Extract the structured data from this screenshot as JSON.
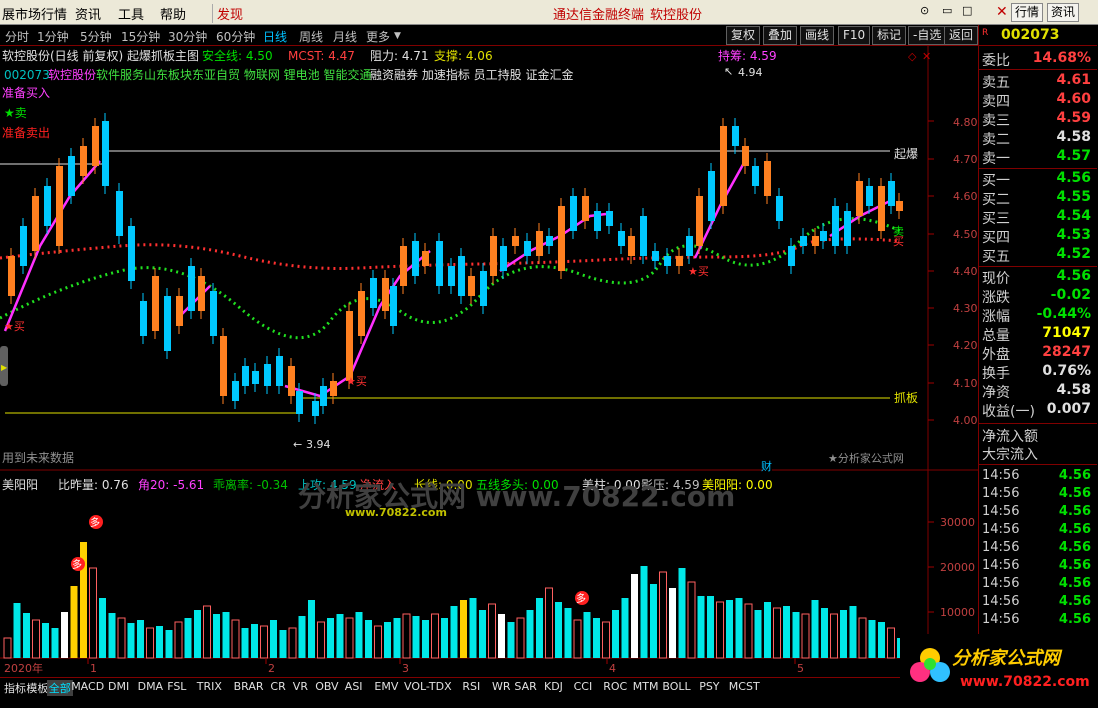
{
  "menu": {
    "items": [
      "展市场行情",
      "资讯",
      "工具",
      "帮助"
    ],
    "discover": "发现",
    "center_brand": "通达信金融终端",
    "stock_short": "软控股份",
    "right_buttons": [
      "行情",
      "资讯"
    ]
  },
  "period_bar": {
    "periods": [
      "分时",
      "1分钟",
      "5分钟",
      "15分钟",
      "30分钟",
      "60分钟",
      "日线",
      "周线",
      "月线",
      "更多"
    ],
    "active": "日线",
    "tools": [
      "复权",
      "叠加",
      "画线",
      "F10",
      "标记",
      "-自选",
      "返回"
    ]
  },
  "main_chart": {
    "title_line": "软控股份(日线 前复权) 起爆抓板主图",
    "safety_label": "安全线: 4.50",
    "mcst_label": "MCST: 4.47",
    "resist_label": "阻力: 4.71",
    "support_label": "支撑: 4.06",
    "info_code": "002073",
    "info_name": "软控股份",
    "info_tags_green": "软件服务山东板块东亚自贸 物联网 锂电池 智能交通",
    "info_tags_white": "融资融券 加速指标 员工持股 证金汇金",
    "legend_buy": "准备买入",
    "legend_star": "★卖",
    "legend_sell": "准备卖出",
    "chip_label": "持筹: 4.59",
    "high_label": "4.94",
    "low_label": "3.94",
    "qibao": "起爆",
    "zhuaban": "抓板",
    "footer_left": "用到未来数据",
    "footer_right": "★分析家公式网",
    "yaxis": [
      "4.80",
      "4.70",
      "4.60",
      "4.50",
      "4.40",
      "4.30",
      "4.20",
      "4.10",
      "4.00"
    ],
    "cai": "财"
  },
  "sub_chart": {
    "name": "美阳阳",
    "labels": [
      {
        "text": "比昨量: 0.76",
        "color": "#e0e0e0"
      },
      {
        "text": "角20: -5.61",
        "color": "#ff40ff"
      },
      {
        "text": "乖离率: -0.34",
        "color": "#00c000"
      },
      {
        "text": "上攻: 4.59",
        "color": "#00c0c0"
      },
      {
        "text": "净流入",
        "color": "#ff4040"
      },
      {
        "text": "长线: 0.00",
        "color": "#e0e000"
      },
      {
        "text": "五线多头: 0.00",
        "color": "#00e000"
      },
      {
        "text": "美柱: 0.00",
        "color": "#e0e0e0"
      },
      {
        "text": "影压: 4.59",
        "color": "#c0c0c0"
      },
      {
        "text": "美阳阳: 0.00",
        "color": "#ffff00"
      }
    ],
    "yaxis": [
      "30000",
      "20000",
      "10000"
    ],
    "watermark": "分析家公式网 www.70822.com",
    "watermark_small": "www.70822.com",
    "duo": "多"
  },
  "time_axis": [
    "2020年",
    "1",
    "2",
    "3",
    "4",
    "5"
  ],
  "right_panel": {
    "code": "002073",
    "r_marker": "R",
    "weibi_label": "委比",
    "weibi_value": "14.68%",
    "sells": [
      {
        "label": "卖五",
        "price": "4.61",
        "color": "#ff4040"
      },
      {
        "label": "卖四",
        "price": "4.60",
        "color": "#ff4040"
      },
      {
        "label": "卖三",
        "price": "4.59",
        "color": "#ff4040"
      },
      {
        "label": "卖二",
        "price": "4.58",
        "color": "#e0e0e0"
      },
      {
        "label": "卖一",
        "price": "4.57",
        "color": "#00e000"
      }
    ],
    "buys": [
      {
        "label": "买一",
        "price": "4.56",
        "color": "#00e000"
      },
      {
        "label": "买二",
        "price": "4.55",
        "color": "#00e000"
      },
      {
        "label": "买三",
        "price": "4.54",
        "color": "#00e000"
      },
      {
        "label": "买四",
        "price": "4.53",
        "color": "#00e000"
      },
      {
        "label": "买五",
        "price": "4.52",
        "color": "#00e000"
      }
    ],
    "stats": [
      {
        "label": "现价",
        "value": "4.56",
        "color": "#00e000"
      },
      {
        "label": "涨跌",
        "value": "-0.02",
        "color": "#00e000"
      },
      {
        "label": "涨幅",
        "value": "-0.44%",
        "color": "#00e000"
      },
      {
        "label": "总量",
        "value": "71047",
        "color": "#ffff00"
      },
      {
        "label": "外盘",
        "value": "28247",
        "color": "#ff4040"
      },
      {
        "label": "换手",
        "value": "0.76%",
        "color": "#e0e0e0"
      },
      {
        "label": "净资",
        "value": "4.58",
        "color": "#e0e0e0"
      },
      {
        "label": "收益(一)",
        "value": "0.007",
        "color": "#e0e0e0"
      }
    ],
    "flow1": "净流入额",
    "flow2": "大宗流入",
    "ticks": [
      {
        "time": "14:56",
        "price": "4.56"
      },
      {
        "time": "14:56",
        "price": "4.56"
      },
      {
        "time": "14:56",
        "price": "4.56"
      },
      {
        "time": "14:56",
        "price": "4.56"
      },
      {
        "time": "14:56",
        "price": "4.56"
      },
      {
        "time": "14:56",
        "price": "4.56"
      },
      {
        "time": "14:56",
        "price": "4.56"
      },
      {
        "time": "14:56",
        "price": "4.56"
      },
      {
        "time": "14:56",
        "price": "4.56"
      }
    ]
  },
  "bottom_tabs": [
    "指标",
    "模板",
    "全部",
    "MACD",
    "DMI",
    "DMA",
    "FSL",
    "TRIX",
    "BRAR",
    "CR",
    "VR",
    "OBV",
    "ASI",
    "EMV",
    "VOL-TDX",
    "RSI",
    "WR",
    "SAR",
    "KDJ",
    "CCI",
    "ROC",
    "MTM",
    "BOLL",
    "PSY",
    "MCST"
  ],
  "bottom_active": "全部",
  "logo": {
    "title": "分析家公式网",
    "url": "www.70822.com"
  },
  "colors": {
    "up": "#ff6020",
    "down": "#00c8ff",
    "panel_border": "#800000"
  }
}
